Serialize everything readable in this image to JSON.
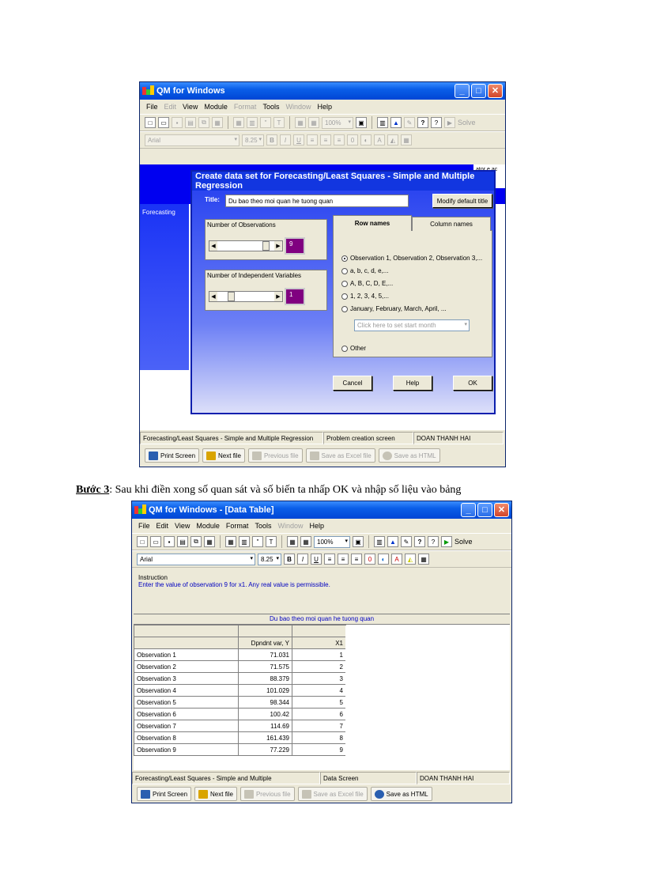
{
  "win1": {
    "title": "QM for Windows",
    "menu": [
      "File",
      "Edit",
      "View",
      "Module",
      "Format",
      "Tools",
      "Window",
      "Help"
    ],
    "menu_disabled": [
      false,
      true,
      false,
      false,
      true,
      false,
      true,
      false
    ],
    "zoom": "100%",
    "solve": "Solve",
    "font": "Arial",
    "font_size": "8.25",
    "side_text": "ator e ac",
    "module_label": "Forecasting",
    "dialog": {
      "title": "Create data set for Forecasting/Least Squares - Simple and Multiple Regression",
      "title_label": "Title:",
      "title_value": "Du bao theo moi quan he tuong quan",
      "modify_btn": "Modify default title",
      "obs_label": "Number of Observations",
      "obs_value": "9",
      "obs_fraction": 0.9,
      "indep_label": "Number of Independent Variables",
      "indep_value": "1",
      "indep_fraction": 0.2,
      "tab_row": "Row names",
      "tab_col": "Column names",
      "options": [
        "Observation 1, Observation 2, Observation 3,...",
        "a, b, c, d, e,...",
        "A, B, C, D, E,...",
        "1, 2, 3, 4, 5,...",
        "January, February, March, April, ..."
      ],
      "month_placeholder": "Click here to set start month",
      "other": "Other",
      "cancel": "Cancel",
      "help": "Help",
      "ok": "OK"
    },
    "status": [
      "Forecasting/Least Squares - Simple and Multiple Regression",
      "Problem creation screen",
      "DOAN THANH HAI"
    ],
    "bottom": [
      "Print Screen",
      "Next file",
      "Previous file",
      "Save as Excel file",
      "Save as HTML"
    ]
  },
  "caption": {
    "bold": "Bước 3",
    "text": ": Sau khi điền xong số quan sát và số biến ta nhấp OK và nhập số liệu vào bảng"
  },
  "win2": {
    "title": "QM for Windows - [Data Table]",
    "menu": [
      "File",
      "Edit",
      "View",
      "Module",
      "Format",
      "Tools",
      "Window",
      "Help"
    ],
    "menu_disabled": [
      false,
      false,
      false,
      false,
      false,
      false,
      true,
      false
    ],
    "zoom": "100%",
    "solve": "Solve",
    "font": "Arial",
    "font_size": "8.25",
    "instruction_header": "Instruction",
    "instruction_text": "Enter the value of observation 9 for x1. Any real value is permissible.",
    "table_title": "Du bao theo moi quan he tuong quan",
    "columns": [
      "",
      "Dpndnt var, Y",
      "X1"
    ],
    "rows": [
      [
        "Observation 1",
        "71.031",
        "1"
      ],
      [
        "Observation 2",
        "71.575",
        "2"
      ],
      [
        "Observation 3",
        "88.379",
        "3"
      ],
      [
        "Observation 4",
        "101.029",
        "4"
      ],
      [
        "Observation 5",
        "98.344",
        "5"
      ],
      [
        "Observation 6",
        "100.42",
        "6"
      ],
      [
        "Observation 7",
        "114.69",
        "7"
      ],
      [
        "Observation 8",
        "161.439",
        "8"
      ],
      [
        "Observation 9",
        "77.229",
        "9"
      ]
    ],
    "status": [
      "Forecasting/Least Squares - Simple and Multiple",
      "Data Screen",
      "DOAN THANH HAI"
    ],
    "bottom": [
      "Print Screen",
      "Next file",
      "Previous file",
      "Save as Excel file",
      "Save as HTML"
    ],
    "bottom_disabled": [
      false,
      false,
      true,
      true,
      false
    ]
  }
}
